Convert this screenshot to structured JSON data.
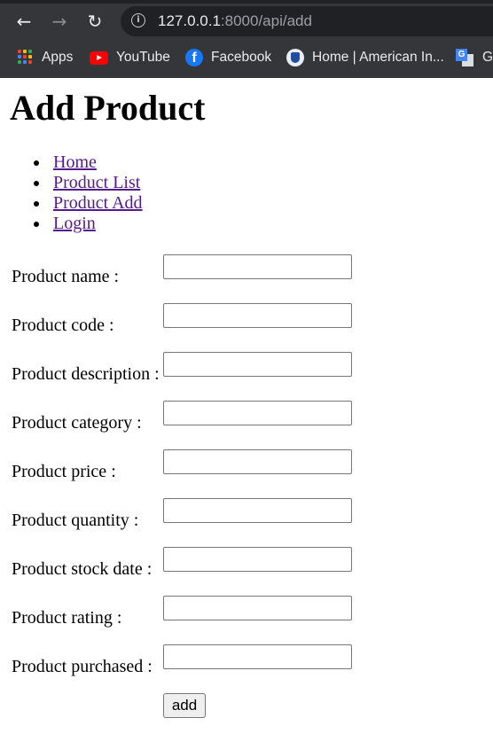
{
  "browser": {
    "url_host": "127.0.0.1",
    "url_rest": ":8000/api/add",
    "bookmarks": [
      {
        "label": "Apps",
        "icon": "apps-grid-icon"
      },
      {
        "label": "YouTube",
        "icon": "youtube-icon"
      },
      {
        "label": "Facebook",
        "icon": "facebook-icon"
      },
      {
        "label": "Home | American In...",
        "icon": "american-institute-icon"
      },
      {
        "label": "G",
        "icon": "google-translate-icon"
      }
    ]
  },
  "page": {
    "title": "Add Product",
    "nav": [
      "Home",
      "Product List",
      "Product Add",
      "Login"
    ],
    "form": {
      "fields": [
        {
          "label": "Product name :",
          "value": ""
        },
        {
          "label": "Product code :",
          "value": ""
        },
        {
          "label": "Product description :",
          "value": ""
        },
        {
          "label": "Product category :",
          "value": ""
        },
        {
          "label": "Product price :",
          "value": ""
        },
        {
          "label": "Product quantity :",
          "value": ""
        },
        {
          "label": "Product stock date :",
          "value": ""
        },
        {
          "label": "Product rating :",
          "value": ""
        },
        {
          "label": "Product purchased :",
          "value": ""
        }
      ],
      "submit_label": "add"
    }
  },
  "colors": {
    "chrome_bg": "#35363a",
    "omnibox_bg": "#202124",
    "link_visited": "#551a8b"
  }
}
